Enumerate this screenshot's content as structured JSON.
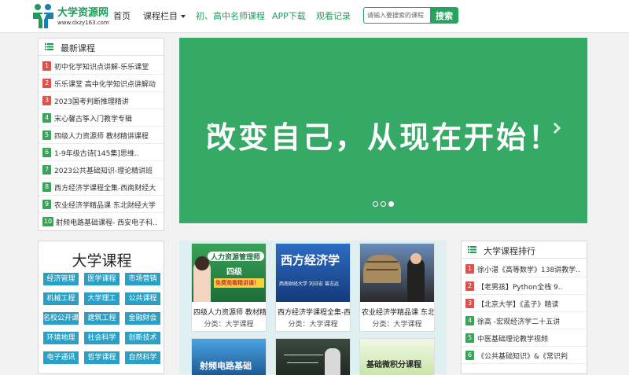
{
  "site": {
    "logo_title": "大学资源网",
    "logo_url": "www.dxzy163.com"
  },
  "nav": {
    "home": "首页",
    "categories": "课程栏目",
    "teachers": "初、高中名师课程",
    "app": "APP下载",
    "history": "观看记录"
  },
  "search": {
    "placeholder": "请输入要搜索的课程",
    "button": "搜索"
  },
  "latest": {
    "title": "最新课程",
    "items": [
      {
        "num": "1",
        "text": "初中化学知识点讲解-乐乐课堂"
      },
      {
        "num": "2",
        "text": "乐乐课堂 高中化学知识点讲解动"
      },
      {
        "num": "3",
        "text": "2023国考判断推理精讲"
      },
      {
        "num": "4",
        "text": "宋心馨古筝入门教学专辑"
      },
      {
        "num": "5",
        "text": "四级人力资源师 教材精讲课程"
      },
      {
        "num": "6",
        "text": "1-9年级古诗[145集]思维.."
      },
      {
        "num": "7",
        "text": "2023公共基础知识-理论精讲班"
      },
      {
        "num": "8",
        "text": "西方经济学课程全集-西南财经大"
      },
      {
        "num": "9",
        "text": "农业经济学精品课 东北财经大学"
      },
      {
        "num": "10",
        "text": "射频电路基础课程- 西安电子科.."
      }
    ]
  },
  "banner": {
    "text": "改变自己，从现在开始！"
  },
  "categories": {
    "title": "大学课程",
    "buttons": [
      "经济管理",
      "医学课程",
      "市场营销",
      "机械工程",
      "大学理工",
      "公共课程",
      "名校公开课",
      "建筑工程",
      "金融财会",
      "环境地理",
      "社会科学",
      "创新技术",
      "电子通讯",
      "哲学课程",
      "自然科学"
    ]
  },
  "courses": [
    {
      "title": "四级人力资源师 教材精讲课程",
      "meta": "分类：大学课程",
      "thumb_line1": "人力资源管理师",
      "thumb_line2": "四级",
      "thumb_line3": "免费观看精讲课！"
    },
    {
      "title": "西方经济学课程全集-西南财经大学",
      "meta": "分类：大学课程",
      "thumb_line1": "西方经济学",
      "thumb_line2": "西南财经大学 刘日宏 曾志远"
    },
    {
      "title": "农业经济学精品课 东北财经大学",
      "meta": "分类：大学课程"
    },
    {
      "title": "射频电路基础",
      "meta": ""
    },
    {
      "title": "",
      "meta": ""
    },
    {
      "title": "基础微积分课程",
      "meta": ""
    }
  ],
  "ranking": {
    "title": "大学课程排行",
    "items": [
      {
        "num": "1",
        "text": "徐小湛《高等数学》138讲教学.."
      },
      {
        "num": "2",
        "text": "【老男孩】Python全栈 9.."
      },
      {
        "num": "3",
        "text": "【北京大学】《孟子》精读"
      },
      {
        "num": "4",
        "text": "徐高 -宏观经济学二十五讲"
      },
      {
        "num": "5",
        "text": "中医基础理论教学视频"
      },
      {
        "num": "6",
        "text": "《公共基础知识》&《常识判"
      }
    ]
  },
  "colors": {
    "brand_green": "#27a35e",
    "banner_green": "#35a965",
    "rank_red": "#d9534f",
    "rank_green": "#3aa35a",
    "cat_blue": "#2aa1c4"
  }
}
